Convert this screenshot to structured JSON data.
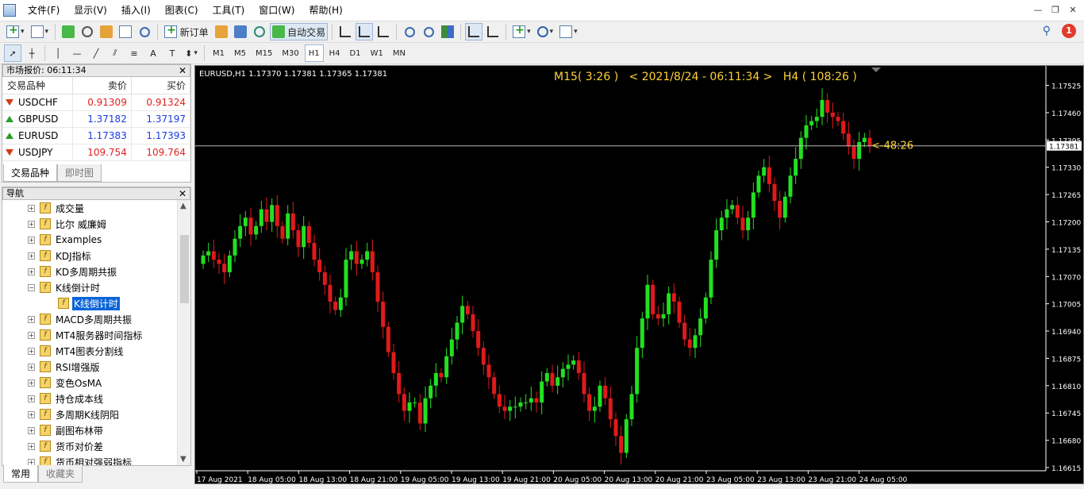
{
  "menu": [
    "文件(F)",
    "显示(V)",
    "插入(I)",
    "图表(C)",
    "工具(T)",
    "窗口(W)",
    "帮助(H)"
  ],
  "toolbar": {
    "new_order": "新订单",
    "auto_trade": "自动交易",
    "timeframes": [
      "M1",
      "M5",
      "M15",
      "M30",
      "H1",
      "H4",
      "D1",
      "W1",
      "MN"
    ],
    "active_tf": "H1",
    "notification_count": "1"
  },
  "market_watch": {
    "title": "市场报价: 06:11:34",
    "headers": [
      "交易品种",
      "卖价",
      "买价"
    ],
    "rows": [
      {
        "symbol": "USDCHF",
        "bid": "0.91309",
        "ask": "0.91324",
        "dir": "down",
        "color": "red"
      },
      {
        "symbol": "GBPUSD",
        "bid": "1.37182",
        "ask": "1.37197",
        "dir": "up",
        "color": "blue"
      },
      {
        "symbol": "EURUSD",
        "bid": "1.17383",
        "ask": "1.17393",
        "dir": "up",
        "color": "blue"
      },
      {
        "symbol": "USDJPY",
        "bid": "109.754",
        "ask": "109.764",
        "dir": "down",
        "color": "red"
      }
    ],
    "tabs": [
      "交易品种",
      "即时图"
    ]
  },
  "navigator": {
    "title": "导航",
    "items": [
      {
        "label": "成交量",
        "child": false
      },
      {
        "label": "比尔 威廉姆",
        "child": false
      },
      {
        "label": "Examples",
        "child": false
      },
      {
        "label": "KDJ指标",
        "child": false
      },
      {
        "label": "KD多周期共振",
        "child": false
      },
      {
        "label": "K线倒计时",
        "child": false,
        "expanded": true
      },
      {
        "label": "K线倒计时",
        "child": true,
        "selected": true
      },
      {
        "label": "MACD多周期共振",
        "child": false
      },
      {
        "label": "MT4服务器时间指标",
        "child": false
      },
      {
        "label": "MT4图表分割线",
        "child": false
      },
      {
        "label": "RSI增强版",
        "child": false
      },
      {
        "label": "变色OsMA",
        "child": false
      },
      {
        "label": "持仓成本线",
        "child": false
      },
      {
        "label": "多周期K线阴阳",
        "child": false
      },
      {
        "label": "副图布林带",
        "child": false
      },
      {
        "label": "货币对价差",
        "child": false
      },
      {
        "label": "货币相对强弱指标",
        "child": false
      }
    ],
    "tabs": [
      "常用",
      "收藏夹"
    ]
  },
  "chart_data": {
    "type": "candlestick",
    "symbol_line": "EURUSD,H1  1.17370 1.17381 1.17365 1.17381",
    "countdown_text": "M15( 3:26 )   < 2021/8/24 - 06:11:34 >   H4 ( 108:26 )",
    "current_price": "1.17381",
    "bar_countdown": "<-48:26",
    "ylim": [
      1.16615,
      1.1756
    ],
    "y_ticks": [
      "1.17525",
      "1.17460",
      "1.17395",
      "1.17330",
      "1.17265",
      "1.17200",
      "1.17135",
      "1.17070",
      "1.17005",
      "1.16940",
      "1.16875",
      "1.16810",
      "1.16745",
      "1.16680",
      "1.16615"
    ],
    "x_ticks": [
      "17 Aug 2021",
      "18 Aug 05:00",
      "18 Aug 13:00",
      "18 Aug 21:00",
      "19 Aug 05:00",
      "19 Aug 13:00",
      "19 Aug 21:00",
      "20 Aug 05:00",
      "20 Aug 13:00",
      "20 Aug 21:00",
      "23 Aug 05:00",
      "23 Aug 13:00",
      "23 Aug 21:00",
      "24 Aug 05:00"
    ],
    "close_path": [
      1.1712,
      1.1713,
      1.1711,
      1.171,
      1.1708,
      1.1712,
      1.1716,
      1.1719,
      1.1721,
      1.1717,
      1.1719,
      1.1723,
      1.172,
      1.1724,
      1.1719,
      1.1716,
      1.1722,
      1.1718,
      1.1714,
      1.1719,
      1.1715,
      1.1711,
      1.1708,
      1.1705,
      1.1701,
      1.1699,
      1.1702,
      1.1711,
      1.1713,
      1.171,
      1.1711,
      1.1713,
      1.1708,
      1.1701,
      1.1695,
      1.1689,
      1.1684,
      1.1679,
      1.1675,
      1.1677,
      1.1677,
      1.1672,
      1.1678,
      1.1681,
      1.1684,
      1.1683,
      1.1688,
      1.1692,
      1.1696,
      1.17,
      1.1698,
      1.1694,
      1.169,
      1.1686,
      1.1683,
      1.1679,
      1.1676,
      1.1675,
      1.1676,
      1.1676,
      1.1677,
      1.1677,
      1.1678,
      1.1677,
      1.1682,
      1.1684,
      1.1681,
      1.1683,
      1.1685,
      1.1686,
      1.1687,
      1.1684,
      1.1679,
      1.1675,
      1.1676,
      1.1681,
      1.1678,
      1.1673,
      1.1669,
      1.1665,
      1.1673,
      1.1679,
      1.169,
      1.1697,
      1.1705,
      1.1698,
      1.1697,
      1.1698,
      1.1703,
      1.1701,
      1.1696,
      1.1692,
      1.169,
      1.1693,
      1.1697,
      1.1702,
      1.1711,
      1.1718,
      1.1721,
      1.1723,
      1.1724,
      1.1721,
      1.1718,
      1.1721,
      1.1727,
      1.1731,
      1.1733,
      1.1729,
      1.1725,
      1.1721,
      1.1726,
      1.1731,
      1.1735,
      1.174,
      1.1743,
      1.1744,
      1.1745,
      1.1749,
      1.1746,
      1.1745,
      1.1744,
      1.1741,
      1.1738,
      1.1735,
      1.1739,
      1.174,
      1.1738
    ]
  }
}
